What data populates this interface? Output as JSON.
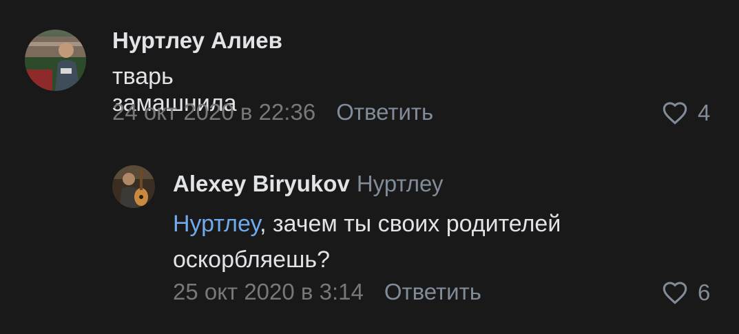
{
  "comments": [
    {
      "author": "Нуртлеу Алиев",
      "text": "тварь замашнила",
      "date": "24 окт 2020 в 22:36",
      "reply_label": "Ответить",
      "likes": "4",
      "avatar_icon": "user-photo-stadium"
    },
    {
      "author": "Alexey Biryukov",
      "reply_to": "Нуртлеу",
      "mention": "Нуртлеу",
      "text_rest_line1": ", зачем ты своих родителей",
      "text_line2": "оскорбляешь?",
      "date": "25 окт 2020 в 3:14",
      "reply_label": "Ответить",
      "likes": "6",
      "avatar_icon": "user-photo-guitar"
    }
  ],
  "colors": {
    "background": "#19191a",
    "text_primary": "#e1e3e6",
    "text_secondary": "#76787a",
    "link": "#71aaeb"
  }
}
